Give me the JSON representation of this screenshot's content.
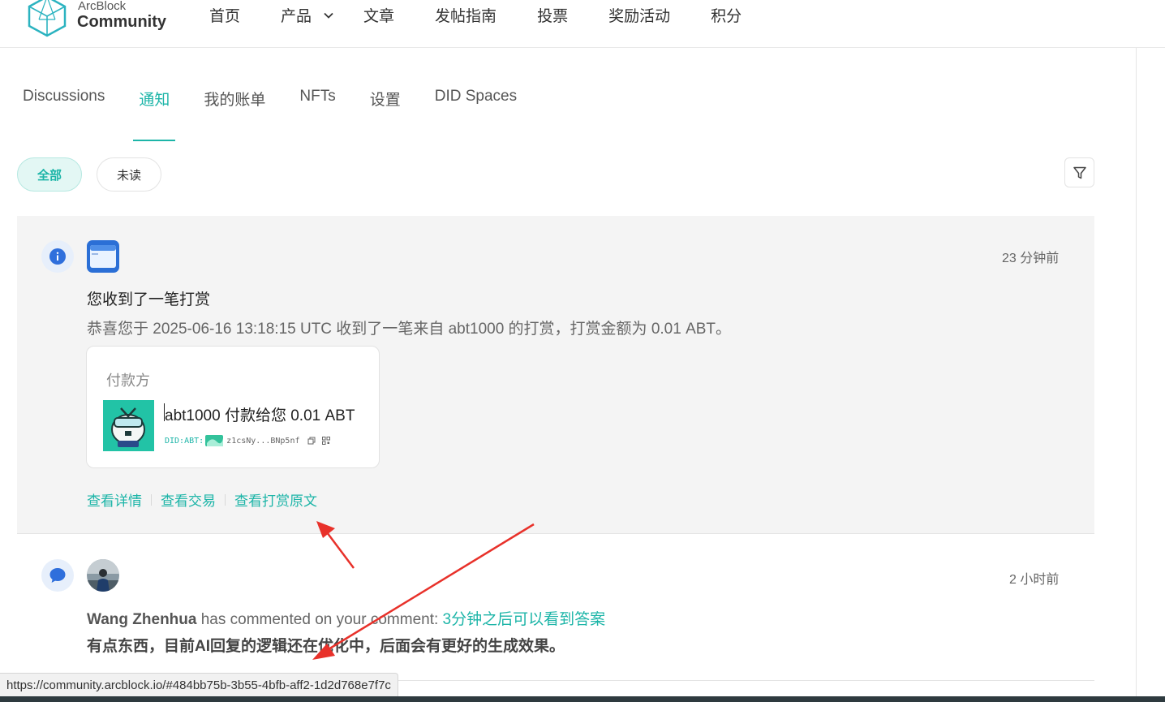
{
  "brand": {
    "top": "ArcBlock",
    "bottom": "Community"
  },
  "nav": [
    {
      "label": "首页"
    },
    {
      "label": "产品"
    },
    {
      "label": "文章"
    },
    {
      "label": "发帖指南"
    },
    {
      "label": "投票"
    },
    {
      "label": "奖励活动"
    },
    {
      "label": "积分"
    }
  ],
  "tabs": [
    {
      "label": "Discussions"
    },
    {
      "label": "通知"
    },
    {
      "label": "我的账单"
    },
    {
      "label": "NFTs"
    },
    {
      "label": "设置"
    },
    {
      "label": "DID Spaces"
    }
  ],
  "filters": {
    "all": "全部",
    "unread": "未读"
  },
  "notifications": [
    {
      "time": "23 分钟前",
      "title": "您收到了一笔打赏",
      "description": "恭喜您于 2025-06-16 13:18:15 UTC 收到了一笔来自 abt1000 的打赏，打赏金额为 0.01 ABT。",
      "payer": {
        "label": "付款方",
        "summary": "abt1000 付款给您 0.01 ABT",
        "did_prefix": "DID:ABT:",
        "did_address": "z1csNy...BNp5nf"
      },
      "links": [
        "查看详情",
        "查看交易",
        "查看打赏原文"
      ]
    },
    {
      "time": "2 小时前",
      "author": "Wang Zhenhua",
      "action": " has commented on your comment: ",
      "target": "3分钟之后可以看到答案",
      "body": "有点东西，目前AI回复的逻辑还在优化中，后面会有更好的生成效果。"
    }
  ],
  "status_url": "https://community.arcblock.io/#484bb75b-3b55-4bfb-aff2-1d2d768e7f7c",
  "colors": {
    "accent": "#1db5a8",
    "arrow": "#e8312a",
    "card_bg": "#f4f4f4"
  }
}
